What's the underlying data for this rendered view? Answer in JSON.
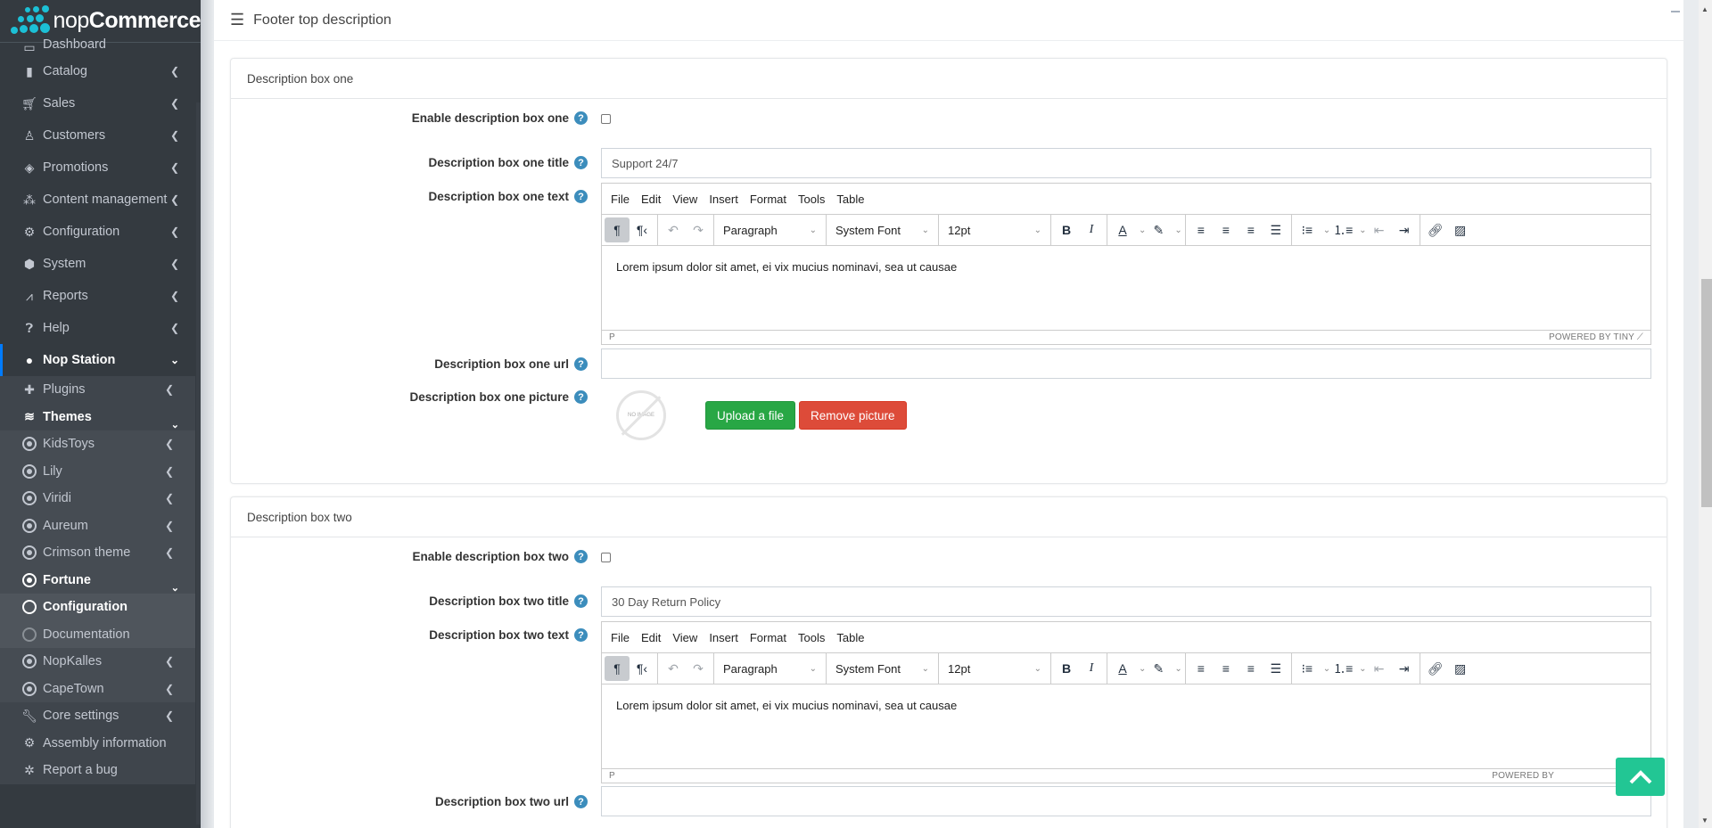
{
  "brand": {
    "prefix": "nop",
    "suffix": "Commerce"
  },
  "sidebar": {
    "items": [
      {
        "label": "Dashboard",
        "icon": "desktop-icon"
      },
      {
        "label": "Catalog",
        "icon": "book-icon"
      },
      {
        "label": "Sales",
        "icon": "cart-icon"
      },
      {
        "label": "Customers",
        "icon": "user-icon"
      },
      {
        "label": "Promotions",
        "icon": "tags-icon"
      },
      {
        "label": "Content management",
        "icon": "cubes-icon"
      },
      {
        "label": "Configuration",
        "icon": "gears-icon"
      },
      {
        "label": "System",
        "icon": "cube-icon"
      },
      {
        "label": "Reports",
        "icon": "chart-line-icon"
      },
      {
        "label": "Help",
        "icon": "question-circle-icon"
      },
      {
        "label": "Nop Station",
        "icon": "pie-icon"
      }
    ],
    "nopstation_children": [
      {
        "label": "Plugins",
        "icon": "puzzle-icon"
      },
      {
        "label": "Themes",
        "icon": "layers-icon"
      }
    ],
    "themes": [
      {
        "label": "KidsToys"
      },
      {
        "label": "Lily"
      },
      {
        "label": "Viridi"
      },
      {
        "label": "Aureum"
      },
      {
        "label": "Crimson theme"
      },
      {
        "label": "Fortune"
      }
    ],
    "fortune_children": [
      {
        "label": "Configuration"
      },
      {
        "label": "Documentation"
      }
    ],
    "themes_after": [
      {
        "label": "NopKalles"
      },
      {
        "label": "CapeTown"
      }
    ],
    "bottom": [
      {
        "label": "Core settings",
        "icon": "wrench-icon"
      },
      {
        "label": "Assembly information",
        "icon": "cog-icon"
      },
      {
        "label": "Report a bug",
        "icon": "bug-icon"
      }
    ]
  },
  "header": {
    "title": "Footer top description"
  },
  "editor": {
    "menus": [
      "File",
      "Edit",
      "View",
      "Insert",
      "Format",
      "Tools",
      "Table"
    ],
    "block_format": "Paragraph",
    "font_family": "System Font",
    "font_size": "12pt",
    "status_path": "P",
    "powered_by": "POWERED BY TINY"
  },
  "box_one": {
    "card_title": "Description box one",
    "enable_label": "Enable description box one",
    "enabled": false,
    "title_label": "Description box one title",
    "title_value": "Support 24/7",
    "text_label": "Description box one text",
    "text_value": "Lorem ipsum dolor sit amet, ei vix mucius nominavi, sea ut causae",
    "url_label": "Description box one url",
    "url_value": "",
    "picture_label": "Description box one picture",
    "no_image": "NO IMAGE",
    "upload_label": "Upload a file",
    "remove_label": "Remove picture"
  },
  "box_two": {
    "card_title": "Description box two",
    "enable_label": "Enable description box two",
    "enabled": false,
    "title_label": "Description box two title",
    "title_value": "30 Day Return Policy",
    "text_label": "Description box two text",
    "text_value": "Lorem ipsum dolor sit amet, ei vix mucius nominavi, sea ut causae",
    "url_label": "Description box two url",
    "url_value": "",
    "powered_by": "POWERED BY"
  },
  "help_glyph": "?",
  "colors": {
    "accent": "#007bff",
    "help": "#3c8dbc",
    "upload": "#28a745",
    "remove": "#dd4b39",
    "back_to_top": "#22c694",
    "brand_dots": "#1cc0d6"
  }
}
